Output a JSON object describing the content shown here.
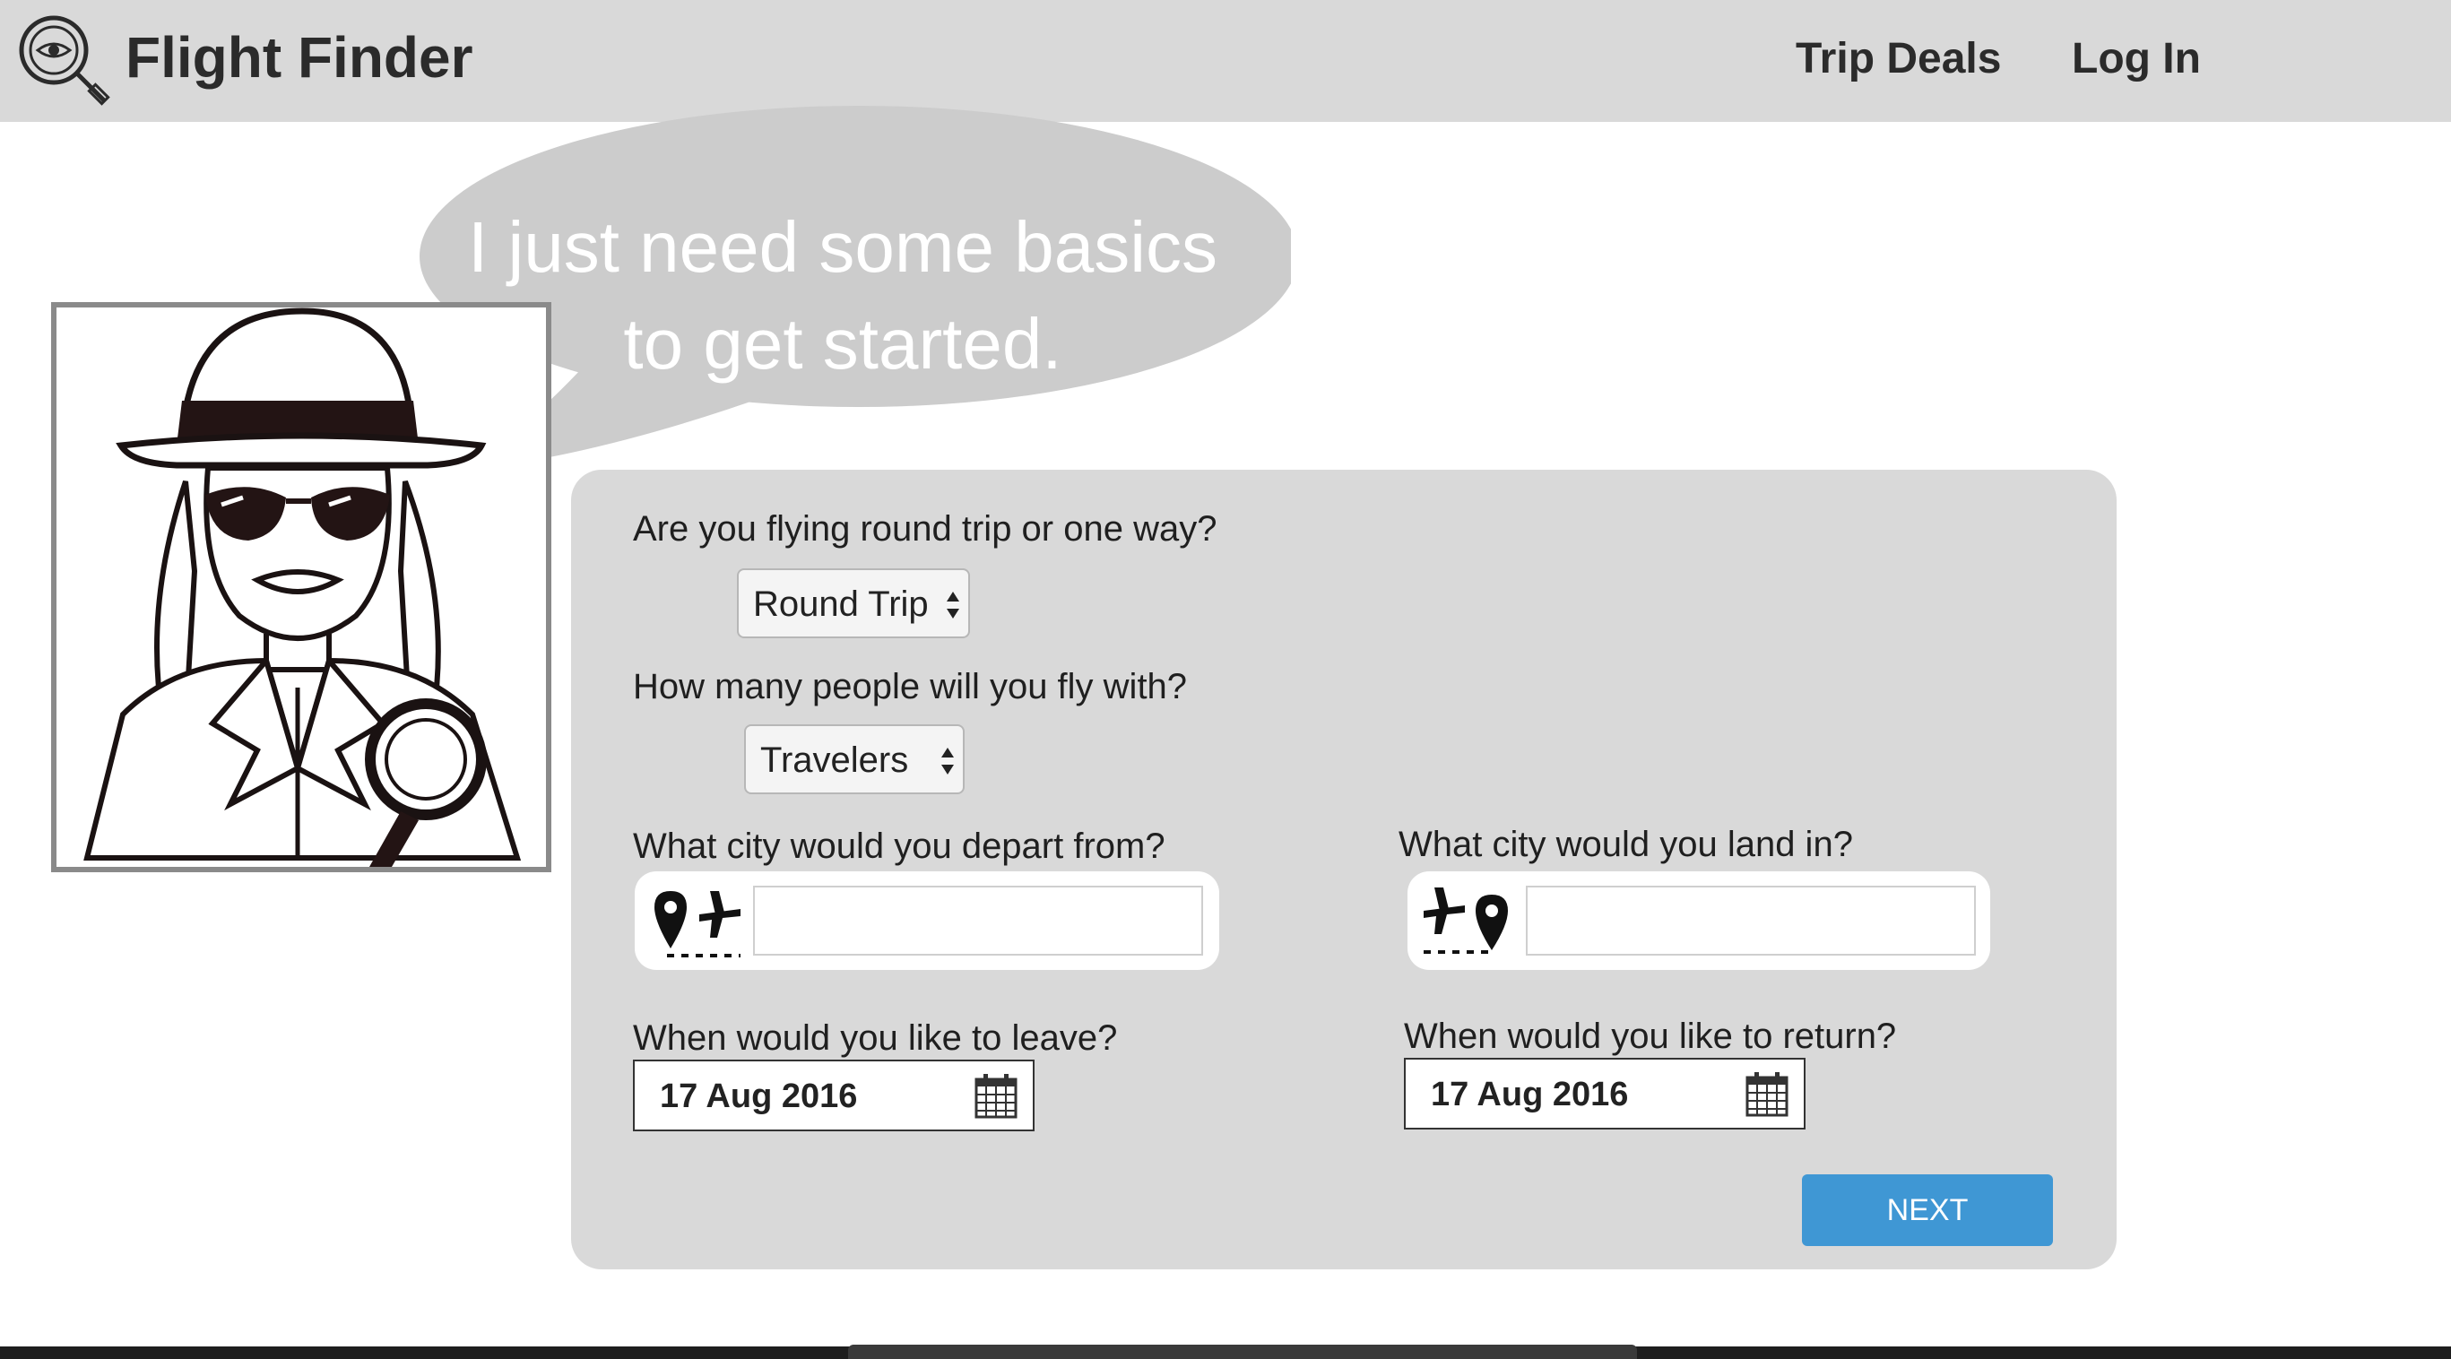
{
  "header": {
    "brand": "Flight Finder",
    "logo_icon": "magnifier-eye-icon",
    "nav": {
      "trip_deals": "Trip Deals",
      "log_in": "Log In"
    }
  },
  "mascot": {
    "icon": "detective-illustration",
    "speech_line_1": "I just need some basics",
    "speech_line_2": "to get started."
  },
  "form": {
    "trip_type": {
      "question": "Are you flying round trip or one way?",
      "selected": "Round Trip"
    },
    "travelers": {
      "question": "How many people will you fly with?",
      "selected": "Travelers"
    },
    "depart_city": {
      "question": "What city would you depart from?",
      "value": "",
      "icon": "pin-departure-plane-icon"
    },
    "arrive_city": {
      "question": "What city would you land in?",
      "value": "",
      "icon": "plane-arrival-pin-icon"
    },
    "leave_date": {
      "question": "When would you like to leave?",
      "value": "17 Aug 2016",
      "icon": "calendar-icon"
    },
    "return_date": {
      "question": "When would you like to return?",
      "value": "17 Aug 2016",
      "icon": "calendar-icon"
    },
    "next_label": "NEXT"
  },
  "colors": {
    "header_bg": "#d9d9d9",
    "panel_bg": "#d9d9d9",
    "bubble_bg": "#cccccc",
    "accent": "#3f97d4"
  }
}
